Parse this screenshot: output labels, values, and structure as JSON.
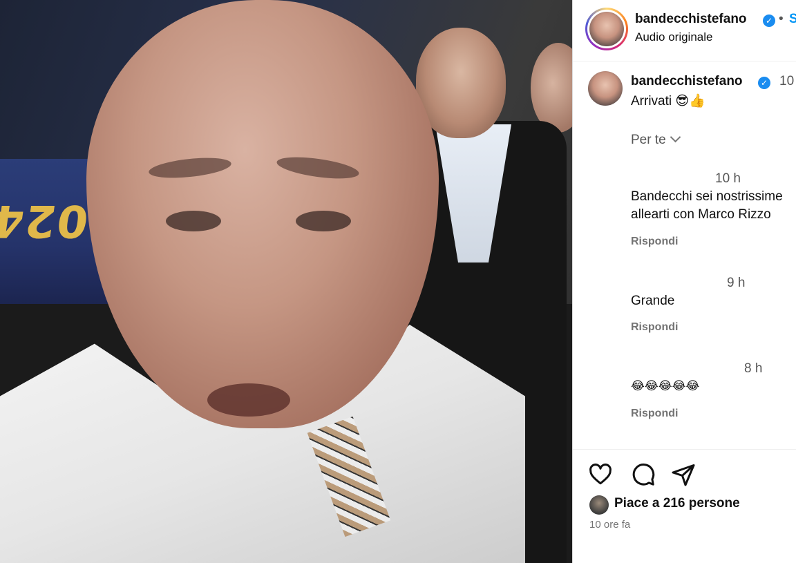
{
  "post": {
    "username": "bandecchistefano",
    "audio": "Audio originale",
    "follow_label": "S",
    "dot": "•",
    "caption": {
      "username": "bandecchistefano",
      "time": "10",
      "text": "Arrivati",
      "emoji": "😎👍"
    }
  },
  "comments_sort": {
    "label": "Per te"
  },
  "comments": [
    {
      "time": "10 h",
      "text_lines": [
        "Bandecchi sei nostrissime",
        "allearti con Marco Rizzo"
      ],
      "reply": "Rispondi"
    },
    {
      "time": "9 h",
      "text_lines": [
        "Grande"
      ],
      "reply": "Rispondi"
    },
    {
      "time": "8 h",
      "text_lines": [
        "😂😂😂😂😂"
      ],
      "reply": "Rispondi"
    }
  ],
  "actions": {
    "icons": [
      "heart-icon",
      "comment-icon",
      "share-icon"
    ],
    "likes_text": "Piace a 216 persone",
    "time_ago": "10 ore fa"
  },
  "video": {
    "banner_text": "024"
  },
  "colors": {
    "link": "#0095f6",
    "verified": "#1a8cf0",
    "secondary_text": "#737373"
  }
}
